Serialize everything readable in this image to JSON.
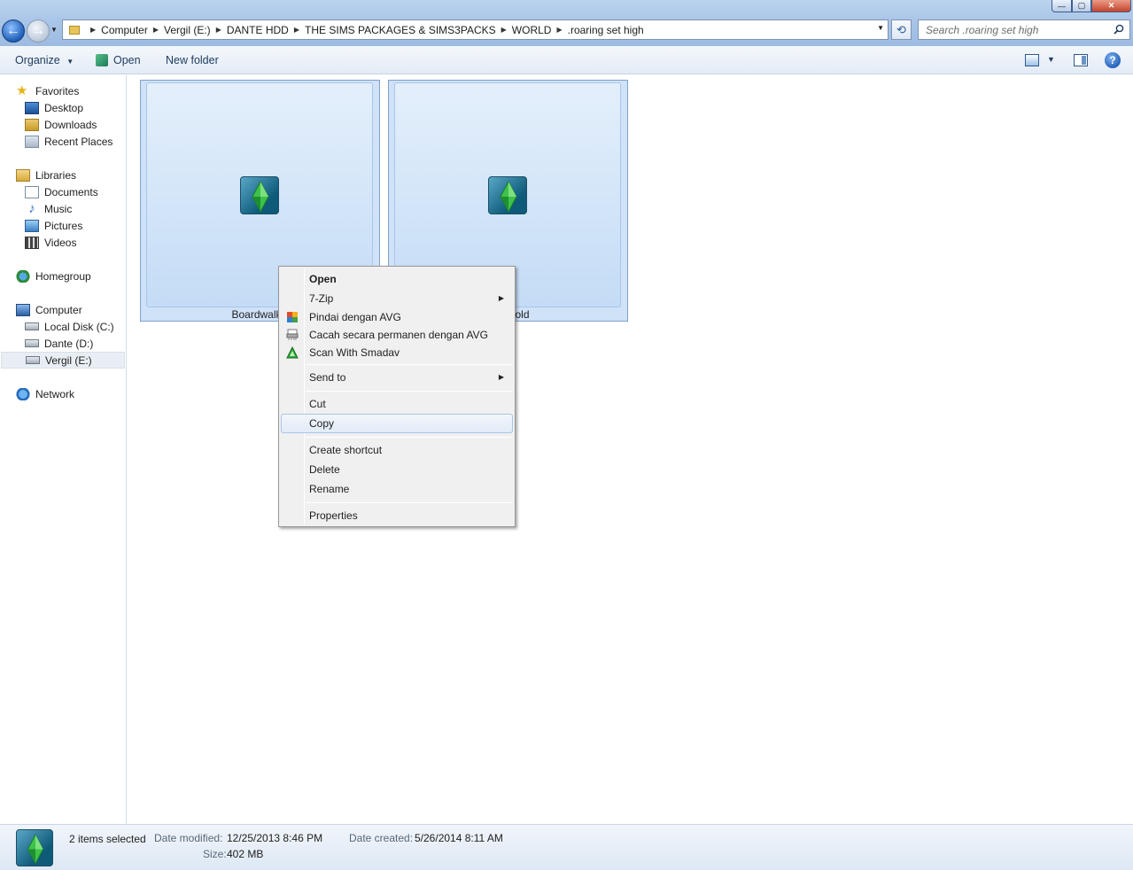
{
  "window": {
    "controls": {
      "minimize": "—",
      "maximize": "▢",
      "close": "✕"
    }
  },
  "navigation": {
    "back_glyph": "←",
    "forward_glyph": "→",
    "refresh_glyph": "⟲"
  },
  "address": {
    "breadcrumbs": [
      "Computer",
      "Vergil (E:)",
      "DANTE HDD",
      "THE SIMS PACKAGES & SIMS3PACKS",
      "WORLD",
      ".roaring set high"
    ]
  },
  "search": {
    "placeholder": "Search .roaring set high"
  },
  "toolbar": {
    "organize": "Organize",
    "open": "Open",
    "new_folder": "New folder",
    "help_glyph": "?"
  },
  "sidebar": {
    "favorites": {
      "label": "Favorites",
      "items": [
        "Desktop",
        "Downloads",
        "Recent Places"
      ]
    },
    "libraries": {
      "label": "Libraries",
      "items": [
        "Documents",
        "Music",
        "Pictures",
        "Videos"
      ]
    },
    "homegroup": {
      "label": "Homegroup"
    },
    "computer": {
      "label": "Computer",
      "items": [
        "Local Disk (C:)",
        "Dante (D:)",
        "Vergil (E:)"
      ],
      "selected": "Vergil (E:)"
    },
    "network": {
      "label": "Network"
    }
  },
  "files": [
    {
      "label": "BoardwalkS",
      "icon": "sims3pack-icon"
    },
    {
      "label": "ghtsGold",
      "icon": "sims3pack-icon"
    }
  ],
  "context_menu": {
    "items": [
      {
        "label": "Open",
        "bold": true
      },
      {
        "label": "7-Zip",
        "submenu": true
      },
      {
        "label": "Pindai dengan AVG",
        "icon": "avg-icon"
      },
      {
        "label": "Cacah secara permanen dengan AVG",
        "icon": "shredder-icon"
      },
      {
        "label": "Scan With Smadav",
        "icon": "smadav-icon"
      },
      {
        "label": "Send to",
        "submenu": true
      },
      {
        "label": "Cut"
      },
      {
        "label": "Copy",
        "highlighted": true
      },
      {
        "label": "Create shortcut"
      },
      {
        "label": "Delete"
      },
      {
        "label": "Rename"
      },
      {
        "label": "Properties"
      }
    ],
    "submenu_glyph": "▶"
  },
  "details": {
    "selection": "2 items selected",
    "date_modified_label": "Date modified:",
    "date_modified": "12/25/2013 8:46 PM",
    "date_created_label": "Date created:",
    "date_created": "5/26/2014 8:11 AM",
    "size_label": "Size:",
    "size": "402 MB"
  },
  "colors": {
    "accent": "#3a7fc5",
    "selection": "#cfe2f8",
    "sims_green": "#3ec24a"
  }
}
